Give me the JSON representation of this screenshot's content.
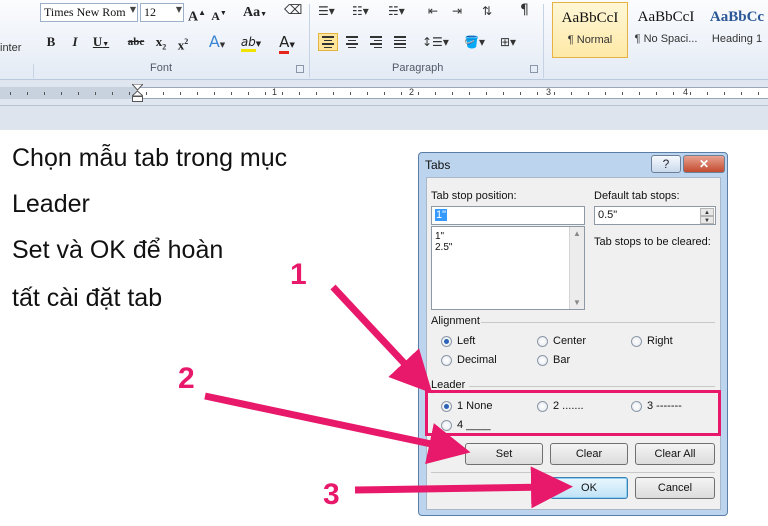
{
  "ribbon": {
    "clipboard_fragment": "inter",
    "font": {
      "name": "Times New Rom",
      "size": "12",
      "group_label": "Font",
      "grow": "A",
      "shrink": "A",
      "case": "Aa",
      "bold": "B",
      "italic": "I",
      "underline": "U",
      "strike": "abc",
      "subscript": "x",
      "superscript": "x",
      "text_effects": "A",
      "highlight": "ab",
      "font_color": "A"
    },
    "paragraph": {
      "group_label": "Paragraph"
    },
    "styles": [
      {
        "sample": "AaBbCcI",
        "name": "¶ Normal"
      },
      {
        "sample": "AaBbCcI",
        "name": "¶ No Spaci..."
      },
      {
        "sample": "AaBbCc",
        "name": "Heading 1"
      }
    ]
  },
  "ruler": {
    "numbers": [
      "1",
      "2",
      "3",
      "4"
    ]
  },
  "instructions": [
    "Chọn mẫu tab trong mục",
    "Leader",
    "Set và OK để hoàn",
    "tất cài đặt tab"
  ],
  "dialog": {
    "title": "Tabs",
    "help": "?",
    "close": "✕",
    "tab_stop_label": "Tab stop position:",
    "tab_stop_value": "1\"",
    "tab_list": [
      "1\"",
      "2.5\""
    ],
    "default_label": "Default tab stops:",
    "default_value": "0.5\"",
    "cleared_label": "Tab stops to be cleared:",
    "alignment_label": "Alignment",
    "alignment": [
      "Left",
      "Center",
      "Right",
      "Decimal",
      "Bar"
    ],
    "leader_label": "Leader",
    "leader": [
      "1 None",
      "2 .......",
      "3 -------",
      "4 ____"
    ],
    "set_label": "Set",
    "clear_label": "Clear",
    "clear_all_label": "Clear All",
    "ok_label": "OK",
    "cancel_label": "Cancel"
  },
  "annotations": {
    "n1": "1",
    "n2": "2",
    "n3": "3",
    "color": "#e8196a"
  }
}
